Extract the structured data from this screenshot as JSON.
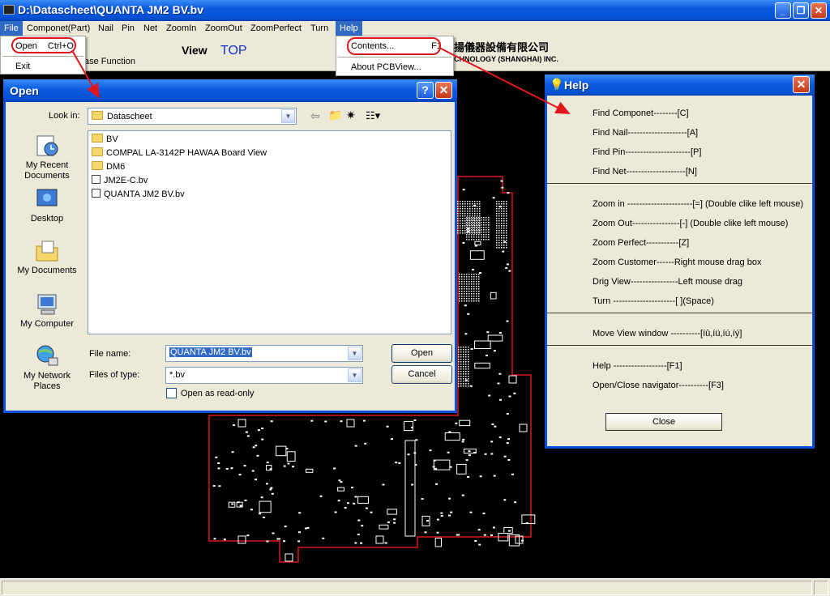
{
  "window": {
    "title": "D:\\Datascheet\\QUANTA JM2 BV.bv",
    "minimize": "_",
    "maximize": "❐",
    "close": "✕"
  },
  "menubar": [
    "File",
    "Componet(Part)",
    "Nail",
    "Pin",
    "Net",
    "ZoomIn",
    "ZoomOut",
    "ZoomPerfect",
    "Turn",
    "Help"
  ],
  "toolbar": {
    "view_label": "View",
    "side_label": "TOP",
    "function_label": "ase Function",
    "company_cn": "揚儀器設備有限公司",
    "company_en": "CHNOLOGY (SHANGHAI) INC."
  },
  "file_menu": {
    "items": [
      {
        "label": "Open",
        "shortcut": "Ctrl+O"
      },
      {
        "label": "Exit",
        "shortcut": ""
      }
    ]
  },
  "help_menu": {
    "items": [
      {
        "label": "Contents...",
        "shortcut": "F1"
      },
      {
        "label": "About PCBView...",
        "shortcut": ""
      }
    ]
  },
  "open_dialog": {
    "title": "Open",
    "help_btn": "?",
    "close_btn": "✕",
    "look_in_label": "Look in:",
    "look_in_value": "Datascheet",
    "places": [
      "My Recent Documents",
      "Desktop",
      "My Documents",
      "My Computer",
      "My Network Places"
    ],
    "files": [
      {
        "name": "BV",
        "kind": "folder"
      },
      {
        "name": "COMPAL LA-3142P HAWAA Board View",
        "kind": "folder"
      },
      {
        "name": "DM6",
        "kind": "folder"
      },
      {
        "name": "JM2E-C.bv",
        "kind": "file"
      },
      {
        "name": "QUANTA JM2 BV.bv",
        "kind": "file"
      }
    ],
    "file_name_label": "File name:",
    "file_name_value": "QUANTA JM2 BV.bv",
    "files_of_type_label": "Files of type:",
    "files_of_type_value": "*.bv",
    "readonly_label": "Open as read-only",
    "open_button": "Open",
    "cancel_button": "Cancel"
  },
  "help_window": {
    "title": "Help",
    "close_btn": "✕",
    "sections": [
      [
        "Find Componet--------[C]",
        "Find Nail--------------------[A]",
        "Find Pin----------------------[P]",
        "Find Net--------------------[N]"
      ],
      [
        "Zoom in ----------------------[=] (Double clike left mouse)",
        "Zoom Out----------------[-] (Double clike left mouse)",
        "Zoom Perfect-----------[Z]",
        "Zoom Customer------Right mouse drag box",
        "Drig View----------------Left mouse drag",
        "Turn ---------------------[ ](Space)"
      ],
      [
        "Move View window ----------[íû,íü,íú,íý]"
      ],
      [
        "Help  ------------------[F1]",
        "Open/Close navigator----------[F3]"
      ]
    ],
    "close_button": "Close"
  },
  "colors": {
    "xp_blue": "#0a5ae0",
    "dialog_face": "#ece9d8",
    "pcb_outline": "#e0161b",
    "annotation_red": "#e0161b",
    "selection": "#316ac5"
  }
}
